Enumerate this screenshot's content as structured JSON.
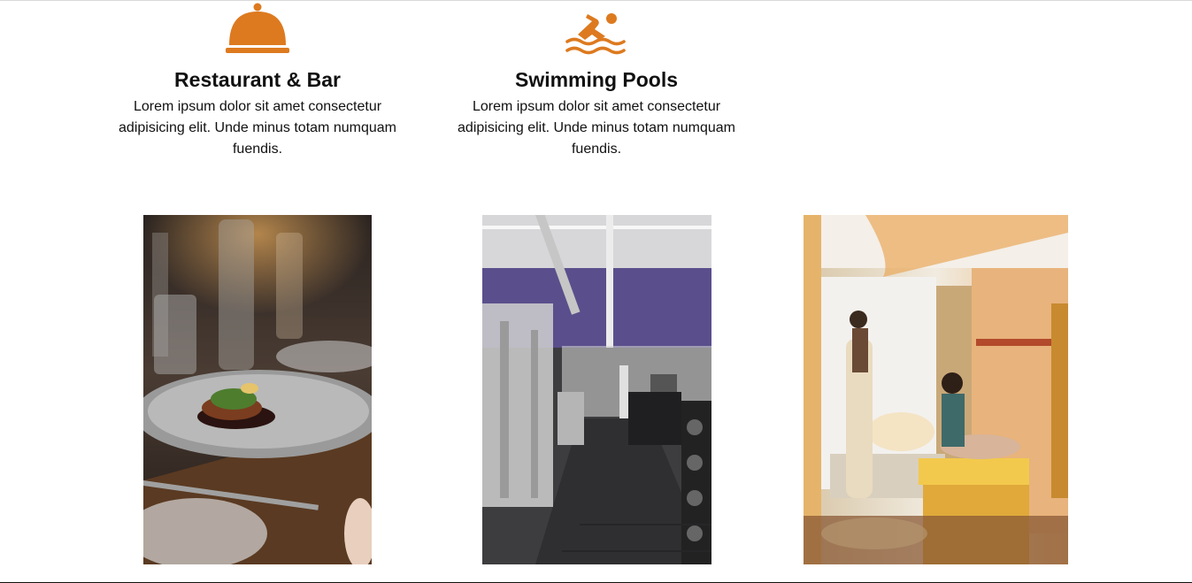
{
  "services": [
    {
      "icon": "cloche-icon",
      "title": "Restaurant & Bar",
      "description": "Lorem ipsum dolor sit amet consectetur adipisicing elit. Unde minus totam numquam fuendis."
    },
    {
      "icon": "swimmer-icon",
      "title": "Swimming Pools",
      "description": "Lorem ipsum dolor sit amet consectetur adipisicing elit. Unde minus totam numquam fuendis."
    }
  ],
  "gallery": [
    {
      "subject": "plated-dish-photo"
    },
    {
      "subject": "gym-interior-photo"
    },
    {
      "subject": "spa-massage-room-photo"
    }
  ],
  "colors": {
    "accent": "#dd7a1f",
    "text": "#111111",
    "background": "#ffffff"
  }
}
